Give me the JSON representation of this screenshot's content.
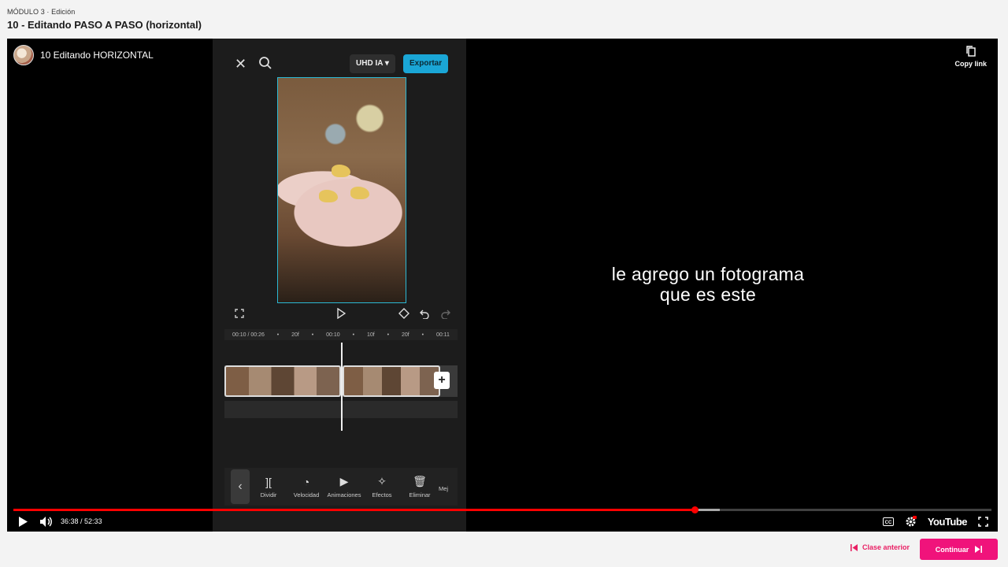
{
  "header": {
    "module": "MÓDULO 3 · Edición",
    "lesson_title": "10 - Editando PASO A PASO (horizontal)"
  },
  "video": {
    "title": "10 Editando HORIZONTAL",
    "copy_link_label": "Copy link",
    "subtitle_line1": "le agrego un fotograma",
    "subtitle_line2": "que es este",
    "time_display": "36:38 / 52:33",
    "played_fraction": 0.6966,
    "buffered_fraction": 0.722,
    "youtube_label": "YouTube",
    "colors": {
      "progress": "#ff0000"
    }
  },
  "capcut": {
    "uhd_label": "UHD IA",
    "export_label": "Exportar",
    "ruler": [
      "00:10 / 00:26",
      "•",
      "20f",
      "•",
      "00:10",
      "•",
      "10f",
      "•",
      "20f",
      "•",
      "00:11"
    ],
    "tools": [
      {
        "icon": "split-icon",
        "glyph": "][",
        "label": "Dividir"
      },
      {
        "icon": "speed-icon",
        "glyph": "◔",
        "label": "Velocidad"
      },
      {
        "icon": "animation-icon",
        "glyph": "▶",
        "label": "Animaciones"
      },
      {
        "icon": "effects-icon",
        "glyph": "✧",
        "label": "Efectos"
      },
      {
        "icon": "delete-icon",
        "glyph": "🗑",
        "label": "Eliminar"
      },
      {
        "icon": "more-icon",
        "glyph": "",
        "label": "Mej"
      }
    ],
    "colors": {
      "export_bg": "#1aa6d6",
      "preview_border": "#2bb8d4"
    }
  },
  "nav": {
    "prev_label": "Clase anterior",
    "next_label": "Continuar",
    "accent": "#f0137b"
  }
}
